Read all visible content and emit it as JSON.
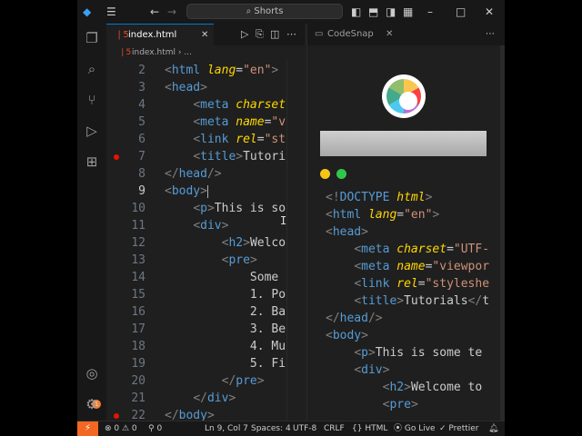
{
  "title_bar": {
    "search": "⌕ Shorts"
  },
  "editor": {
    "tab": {
      "name": "index.html",
      "close": "✕"
    },
    "breadcrumb": {
      "file": "index.html",
      "more": "..."
    },
    "lines": [
      {
        "n": "2",
        "html": "<span class=\"p\">&lt;</span><span class=\"t\">html</span> <span class=\"a\">lang</span>=<span class=\"s\">\"en\"</span><span class=\"p\">&gt;</span>"
      },
      {
        "n": "3",
        "html": "<span class=\"p\">&lt;</span><span class=\"t\">head</span><span class=\"p\">&gt;</span>"
      },
      {
        "n": "4",
        "html": "    <span class=\"p\">&lt;</span><span class=\"t\">meta</span> <span class=\"a\">charset</span>"
      },
      {
        "n": "5",
        "html": "    <span class=\"p\">&lt;</span><span class=\"t\">meta</span> <span class=\"a\">name</span>=<span class=\"s\">\"v</span>"
      },
      {
        "n": "6",
        "html": "    <span class=\"p\">&lt;</span><span class=\"t\">link</span> <span class=\"a\">rel</span>=<span class=\"s\">\"st</span>"
      },
      {
        "n": "7",
        "html": "    <span class=\"p\">&lt;</span><span class=\"t\">title</span><span class=\"p\">&gt;</span>Tutori"
      },
      {
        "n": "8",
        "html": "<span class=\"p\">&lt;/</span><span class=\"t\">head</span><span class=\"p\">/&gt;</span>"
      },
      {
        "n": "9",
        "html": "<span class=\"p\">&lt;</span><span class=\"t\">body</span><span class=\"p\">&gt;</span><span class=\"caret\"></span>"
      },
      {
        "n": "10",
        "html": "    <span class=\"p\">&lt;</span><span class=\"t\">p</span><span class=\"p\">&gt;</span>This is so"
      },
      {
        "n": "11",
        "html": "    <span class=\"p\">&lt;</span><span class=\"t\">div</span><span class=\"p\">&gt;</span>"
      },
      {
        "n": "12",
        "html": "        <span class=\"p\">&lt;</span><span class=\"t\">h2</span><span class=\"p\">&gt;</span>Welco"
      },
      {
        "n": "13",
        "html": "        <span class=\"p\">&lt;</span><span class=\"t\">pre</span><span class=\"p\">&gt;</span>"
      },
      {
        "n": "14",
        "html": "            Some"
      },
      {
        "n": "15",
        "html": "            1. Po"
      },
      {
        "n": "16",
        "html": "            2. Ba"
      },
      {
        "n": "17",
        "html": "            3. Be"
      },
      {
        "n": "18",
        "html": "            4. Mu"
      },
      {
        "n": "19",
        "html": "            5. Fi"
      },
      {
        "n": "20",
        "html": "        <span class=\"p\">&lt;/</span><span class=\"t\">pre</span><span class=\"p\">&gt;</span>"
      },
      {
        "n": "21",
        "html": "    <span class=\"p\">&lt;/</span><span class=\"t\">div</span><span class=\"p\">&gt;</span>"
      },
      {
        "n": "22",
        "html": "<span class=\"p\">&lt;/</span><span class=\"t\">body</span><span class=\"p\">&gt;</span>"
      }
    ]
  },
  "codesnap": {
    "tab": {
      "name": "CodeSnap",
      "close": "✕"
    },
    "lines": [
      {
        "html": "<span class=\"p\">&lt;!</span><span class=\"t\">DOCTYPE</span> <span class=\"a\">html</span><span class=\"p\">&gt;</span>"
      },
      {
        "html": "<span class=\"p\">&lt;</span><span class=\"t\">html</span> <span class=\"a\">lang</span>=<span class=\"s\">\"en\"</span><span class=\"p\">&gt;</span>"
      },
      {
        "html": "<span class=\"p\">&lt;</span><span class=\"t\">head</span><span class=\"p\">&gt;</span>"
      },
      {
        "html": "    <span class=\"p\">&lt;</span><span class=\"t\">meta</span> <span class=\"a\">charset</span>=<span class=\"s\">\"UTF-</span>"
      },
      {
        "html": "    <span class=\"p\">&lt;</span><span class=\"t\">meta</span> <span class=\"a\">name</span>=<span class=\"s\">\"viewpor</span>"
      },
      {
        "html": "    <span class=\"p\">&lt;</span><span class=\"t\">link</span> <span class=\"a\">rel</span>=<span class=\"s\">\"styleshe</span>"
      },
      {
        "html": "    <span class=\"p\">&lt;</span><span class=\"t\">title</span><span class=\"p\">&gt;</span>Tutorials<span class=\"p\">&lt;/</span>t"
      },
      {
        "html": "<span class=\"p\">&lt;/</span><span class=\"t\">head</span><span class=\"p\">/&gt;</span>"
      },
      {
        "html": "<span class=\"p\">&lt;</span><span class=\"t\">body</span><span class=\"p\">&gt;</span>"
      },
      {
        "html": "    <span class=\"p\">&lt;</span><span class=\"t\">p</span><span class=\"p\">&gt;</span>This is some te"
      },
      {
        "html": "    <span class=\"p\">&lt;</span><span class=\"t\">div</span><span class=\"p\">&gt;</span>"
      },
      {
        "html": "        <span class=\"p\">&lt;</span><span class=\"t\">h2</span><span class=\"p\">&gt;</span>Welcome to"
      },
      {
        "html": "        <span class=\"p\">&lt;</span><span class=\"t\">pre</span><span class=\"p\">&gt;</span>"
      }
    ]
  },
  "status_bar": {
    "problems": "⊗ 0 ⚠ 0",
    "ports": "⚲ 0",
    "position": "Ln 9, Col 7",
    "spaces": "Spaces: 4",
    "encoding": "UTF-8",
    "eol": "CRLF",
    "language": "{} HTML",
    "go_live": "⦿ Go Live",
    "prettier": "✓ Prettier"
  },
  "colors": {
    "accent": "#0078d4",
    "remote": "#f26722",
    "breakpoint": "#e51400",
    "tag": "#569cd6",
    "attribute": "#ffd700",
    "string": "#ce9178"
  }
}
